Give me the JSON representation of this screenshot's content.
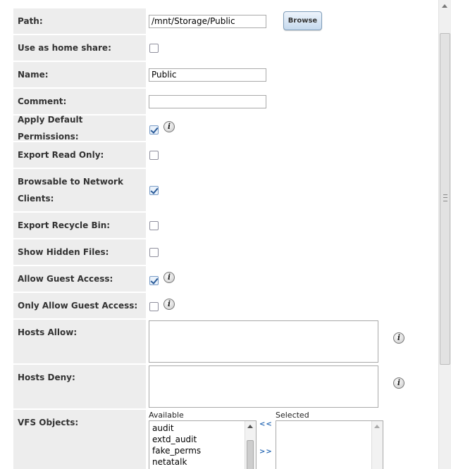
{
  "form": {
    "path": {
      "label": "Path:",
      "value": "/mnt/Storage/Public",
      "browse_label": "Browse"
    },
    "home_share": {
      "label": "Use as home share:",
      "checked": false
    },
    "name": {
      "label": "Name:",
      "value": "Public"
    },
    "comment": {
      "label": "Comment:",
      "value": ""
    },
    "default_permissions": {
      "label": "Apply Default Permissions:",
      "checked": true
    },
    "read_only": {
      "label": "Export Read Only:",
      "checked": false
    },
    "browsable": {
      "label": "Browsable to Network Clients:",
      "checked": true
    },
    "recycle_bin": {
      "label": "Export Recycle Bin:",
      "checked": false
    },
    "hidden_files": {
      "label": "Show Hidden Files:",
      "checked": false
    },
    "guest_access": {
      "label": "Allow Guest Access:",
      "checked": true
    },
    "guest_only": {
      "label": "Only Allow Guest Access:",
      "checked": false
    },
    "hosts_allow": {
      "label": "Hosts Allow:",
      "value": ""
    },
    "hosts_deny": {
      "label": "Hosts Deny:",
      "value": ""
    },
    "vfs": {
      "label": "VFS Objects:",
      "available_label": "Available",
      "selected_label": "Selected",
      "add_label": "<<",
      "remove_label": ">>",
      "available": [
        "audit",
        "extd_audit",
        "fake_perms",
        "netatalk"
      ],
      "selected": []
    }
  },
  "icons": {
    "info": "info-icon",
    "checkmark": "check-icon"
  },
  "colors": {
    "label_bg": "#ededed",
    "button_accent": "#c5d9ee",
    "link": "#2a6bb5"
  }
}
